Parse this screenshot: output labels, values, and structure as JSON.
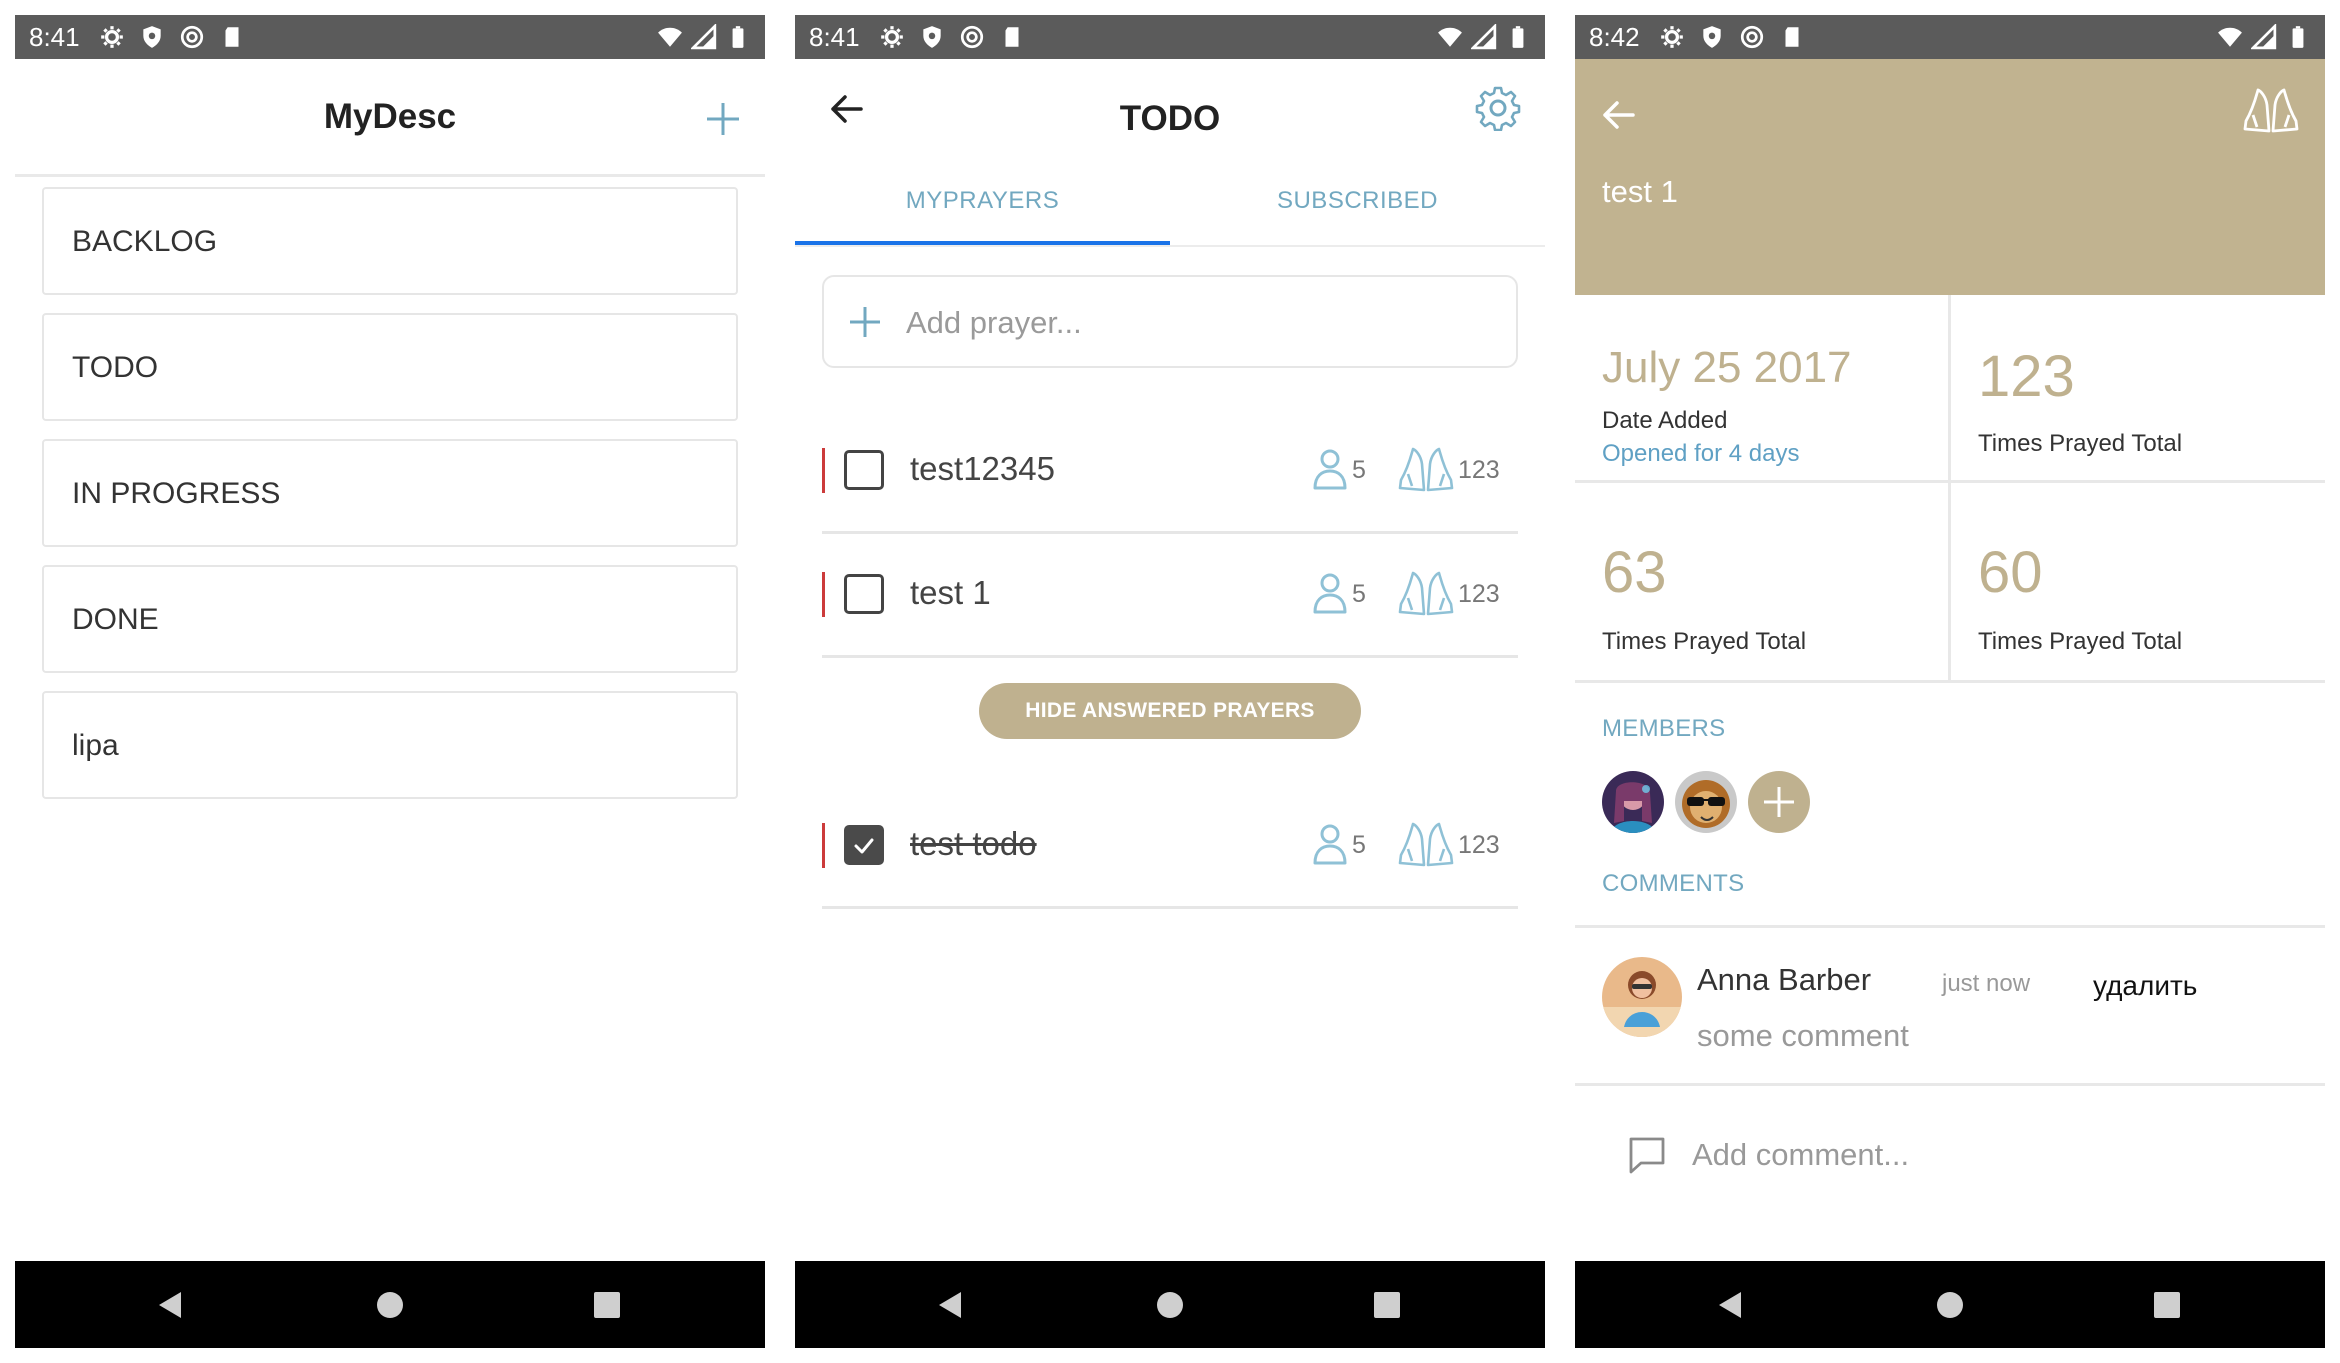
{
  "colors": {
    "statusbar": "#5b5b5b",
    "accent_blue": "#72a8c0",
    "tab_underline": "#1a73e8",
    "gold": "#bfb18f",
    "header_gold": "#c1b390",
    "red_marker": "#cc3b3b"
  },
  "screen1": {
    "status": {
      "time": "8:41"
    },
    "header": {
      "title": "MyDesc",
      "add_icon": "plus-icon"
    },
    "desks": [
      {
        "label": "BACKLOG"
      },
      {
        "label": "TODO"
      },
      {
        "label": "IN PROGRESS"
      },
      {
        "label": "DONE"
      },
      {
        "label": "lipa"
      }
    ]
  },
  "screen2": {
    "status": {
      "time": "8:41"
    },
    "header": {
      "title": "TODO",
      "back_icon": "arrow-left-icon",
      "settings_icon": "gear-icon"
    },
    "tabs": [
      {
        "label": "MYPRAYERS",
        "active": true
      },
      {
        "label": "SUBSCRIBED",
        "active": false
      }
    ],
    "add_prayer": {
      "placeholder": "Add prayer..."
    },
    "prayers": [
      {
        "title": "test12345",
        "checked": false,
        "members": "5",
        "prayed": "123"
      },
      {
        "title": "test 1",
        "checked": false,
        "members": "5",
        "prayed": "123"
      }
    ],
    "hide_button": "HIDE ANSWERED PRAYERS",
    "answered": [
      {
        "title": "test todo",
        "checked": true,
        "members": "5",
        "prayed": "123"
      }
    ]
  },
  "screen3": {
    "status": {
      "time": "8:42"
    },
    "header": {
      "title": "test 1",
      "back_icon": "arrow-left-icon",
      "pray_icon": "praying-hands-icon"
    },
    "stats": {
      "date": "July 25 2017",
      "date_label": "Date Added",
      "opened": "Opened for 4 days",
      "total1": "123",
      "total1_label": "Times Prayed Total",
      "total2": "63",
      "total2_label": "Times Prayed Total",
      "total3": "60",
      "total3_label": "Times Prayed Total"
    },
    "members_label": "MEMBERS",
    "comments_label": "COMMENTS",
    "comment": {
      "author": "Anna Barber",
      "time": "just now",
      "delete": "удалить",
      "text": "some comment"
    },
    "add_comment": {
      "placeholder": "Add comment..."
    }
  }
}
